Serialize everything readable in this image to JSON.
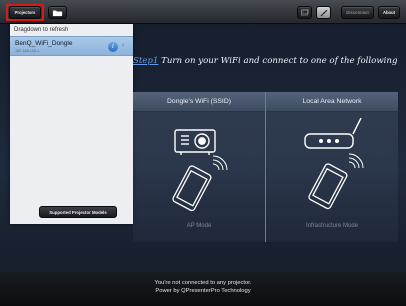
{
  "toolbar": {
    "projectors_label": "Projectors",
    "disconnect_label": "Disconnect",
    "about_label": "About",
    "icons": [
      "folder-icon",
      "window-icon",
      "brush-icon"
    ]
  },
  "left_panel": {
    "pull_hint": "Dragdown to refresh",
    "device": {
      "name": "BenQ_WiFi_Dongle",
      "ip": "192.168.168.1"
    },
    "supported_models_label": "Supported Projector Models"
  },
  "instruction": {
    "step_label": "Step1",
    "text": " Turn on your WiFi and connect to one of the following"
  },
  "connection": {
    "dongle_header": "Dongle's WiFi (SSID)",
    "lan_header": "Local Area Network",
    "ap_mode": "AP Mode",
    "infra_mode": "Infrastructure Mode"
  },
  "footer": {
    "status": "You're not connected to any projector.",
    "credit": "Power by QPresenterPro Technology"
  },
  "colors": {
    "highlight": "#d61b1b",
    "step_accent": "#5f9dea",
    "selected_row": "#a9c9e9"
  }
}
